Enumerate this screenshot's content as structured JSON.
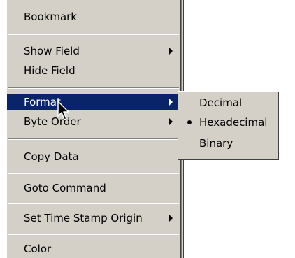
{
  "context_menu": {
    "items": [
      {
        "label": "Bookmark"
      },
      {
        "label": "Show Field"
      },
      {
        "label": "Hide Field"
      },
      {
        "label": "Format"
      },
      {
        "label": "Byte Order"
      },
      {
        "label": "Copy Data"
      },
      {
        "label": "Goto Command"
      },
      {
        "label": "Set Time Stamp Origin"
      },
      {
        "label": "Color"
      }
    ]
  },
  "format_submenu": {
    "items": [
      {
        "label": "Decimal"
      },
      {
        "label": "Hexadecimal"
      },
      {
        "label": "Binary"
      }
    ],
    "selected": "Hexadecimal"
  },
  "colors": {
    "menu_bg": "#d4d0c8",
    "highlight": "#0a246a"
  },
  "icons": {
    "submenu_arrow": "submenu-arrow-icon",
    "selected_bullet": "radio-bullet-icon",
    "cursor": "mouse-pointer-icon"
  }
}
